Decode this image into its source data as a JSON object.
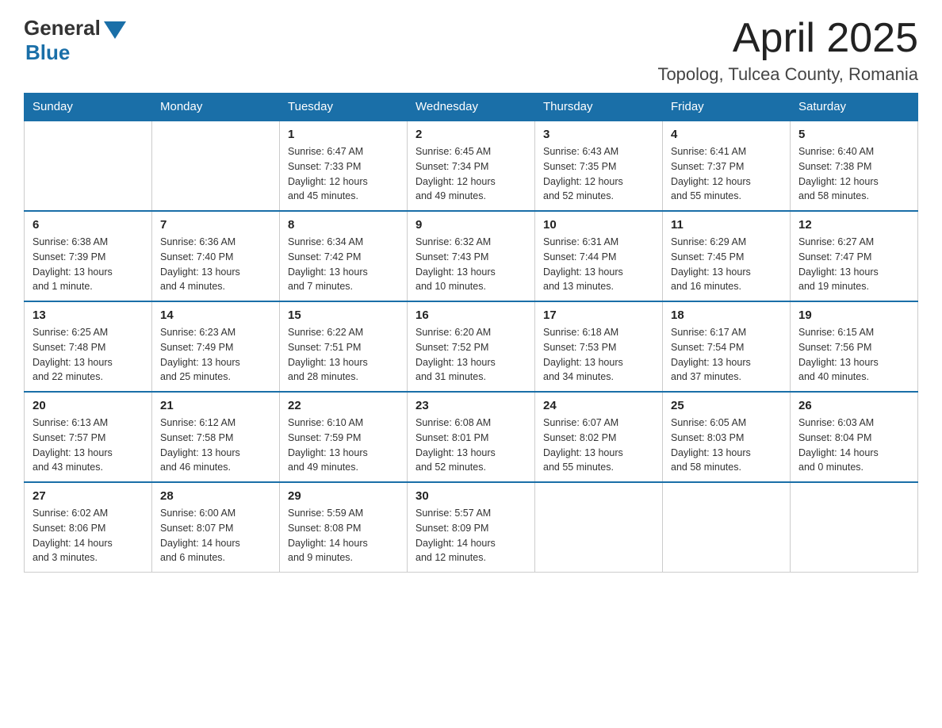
{
  "logo": {
    "general": "General",
    "blue": "Blue"
  },
  "header": {
    "month": "April 2025",
    "location": "Topolog, Tulcea County, Romania"
  },
  "days_of_week": [
    "Sunday",
    "Monday",
    "Tuesday",
    "Wednesday",
    "Thursday",
    "Friday",
    "Saturday"
  ],
  "weeks": [
    [
      {
        "day": "",
        "info": ""
      },
      {
        "day": "",
        "info": ""
      },
      {
        "day": "1",
        "info": "Sunrise: 6:47 AM\nSunset: 7:33 PM\nDaylight: 12 hours\nand 45 minutes."
      },
      {
        "day": "2",
        "info": "Sunrise: 6:45 AM\nSunset: 7:34 PM\nDaylight: 12 hours\nand 49 minutes."
      },
      {
        "day": "3",
        "info": "Sunrise: 6:43 AM\nSunset: 7:35 PM\nDaylight: 12 hours\nand 52 minutes."
      },
      {
        "day": "4",
        "info": "Sunrise: 6:41 AM\nSunset: 7:37 PM\nDaylight: 12 hours\nand 55 minutes."
      },
      {
        "day": "5",
        "info": "Sunrise: 6:40 AM\nSunset: 7:38 PM\nDaylight: 12 hours\nand 58 minutes."
      }
    ],
    [
      {
        "day": "6",
        "info": "Sunrise: 6:38 AM\nSunset: 7:39 PM\nDaylight: 13 hours\nand 1 minute."
      },
      {
        "day": "7",
        "info": "Sunrise: 6:36 AM\nSunset: 7:40 PM\nDaylight: 13 hours\nand 4 minutes."
      },
      {
        "day": "8",
        "info": "Sunrise: 6:34 AM\nSunset: 7:42 PM\nDaylight: 13 hours\nand 7 minutes."
      },
      {
        "day": "9",
        "info": "Sunrise: 6:32 AM\nSunset: 7:43 PM\nDaylight: 13 hours\nand 10 minutes."
      },
      {
        "day": "10",
        "info": "Sunrise: 6:31 AM\nSunset: 7:44 PM\nDaylight: 13 hours\nand 13 minutes."
      },
      {
        "day": "11",
        "info": "Sunrise: 6:29 AM\nSunset: 7:45 PM\nDaylight: 13 hours\nand 16 minutes."
      },
      {
        "day": "12",
        "info": "Sunrise: 6:27 AM\nSunset: 7:47 PM\nDaylight: 13 hours\nand 19 minutes."
      }
    ],
    [
      {
        "day": "13",
        "info": "Sunrise: 6:25 AM\nSunset: 7:48 PM\nDaylight: 13 hours\nand 22 minutes."
      },
      {
        "day": "14",
        "info": "Sunrise: 6:23 AM\nSunset: 7:49 PM\nDaylight: 13 hours\nand 25 minutes."
      },
      {
        "day": "15",
        "info": "Sunrise: 6:22 AM\nSunset: 7:51 PM\nDaylight: 13 hours\nand 28 minutes."
      },
      {
        "day": "16",
        "info": "Sunrise: 6:20 AM\nSunset: 7:52 PM\nDaylight: 13 hours\nand 31 minutes."
      },
      {
        "day": "17",
        "info": "Sunrise: 6:18 AM\nSunset: 7:53 PM\nDaylight: 13 hours\nand 34 minutes."
      },
      {
        "day": "18",
        "info": "Sunrise: 6:17 AM\nSunset: 7:54 PM\nDaylight: 13 hours\nand 37 minutes."
      },
      {
        "day": "19",
        "info": "Sunrise: 6:15 AM\nSunset: 7:56 PM\nDaylight: 13 hours\nand 40 minutes."
      }
    ],
    [
      {
        "day": "20",
        "info": "Sunrise: 6:13 AM\nSunset: 7:57 PM\nDaylight: 13 hours\nand 43 minutes."
      },
      {
        "day": "21",
        "info": "Sunrise: 6:12 AM\nSunset: 7:58 PM\nDaylight: 13 hours\nand 46 minutes."
      },
      {
        "day": "22",
        "info": "Sunrise: 6:10 AM\nSunset: 7:59 PM\nDaylight: 13 hours\nand 49 minutes."
      },
      {
        "day": "23",
        "info": "Sunrise: 6:08 AM\nSunset: 8:01 PM\nDaylight: 13 hours\nand 52 minutes."
      },
      {
        "day": "24",
        "info": "Sunrise: 6:07 AM\nSunset: 8:02 PM\nDaylight: 13 hours\nand 55 minutes."
      },
      {
        "day": "25",
        "info": "Sunrise: 6:05 AM\nSunset: 8:03 PM\nDaylight: 13 hours\nand 58 minutes."
      },
      {
        "day": "26",
        "info": "Sunrise: 6:03 AM\nSunset: 8:04 PM\nDaylight: 14 hours\nand 0 minutes."
      }
    ],
    [
      {
        "day": "27",
        "info": "Sunrise: 6:02 AM\nSunset: 8:06 PM\nDaylight: 14 hours\nand 3 minutes."
      },
      {
        "day": "28",
        "info": "Sunrise: 6:00 AM\nSunset: 8:07 PM\nDaylight: 14 hours\nand 6 minutes."
      },
      {
        "day": "29",
        "info": "Sunrise: 5:59 AM\nSunset: 8:08 PM\nDaylight: 14 hours\nand 9 minutes."
      },
      {
        "day": "30",
        "info": "Sunrise: 5:57 AM\nSunset: 8:09 PM\nDaylight: 14 hours\nand 12 minutes."
      },
      {
        "day": "",
        "info": ""
      },
      {
        "day": "",
        "info": ""
      },
      {
        "day": "",
        "info": ""
      }
    ]
  ]
}
